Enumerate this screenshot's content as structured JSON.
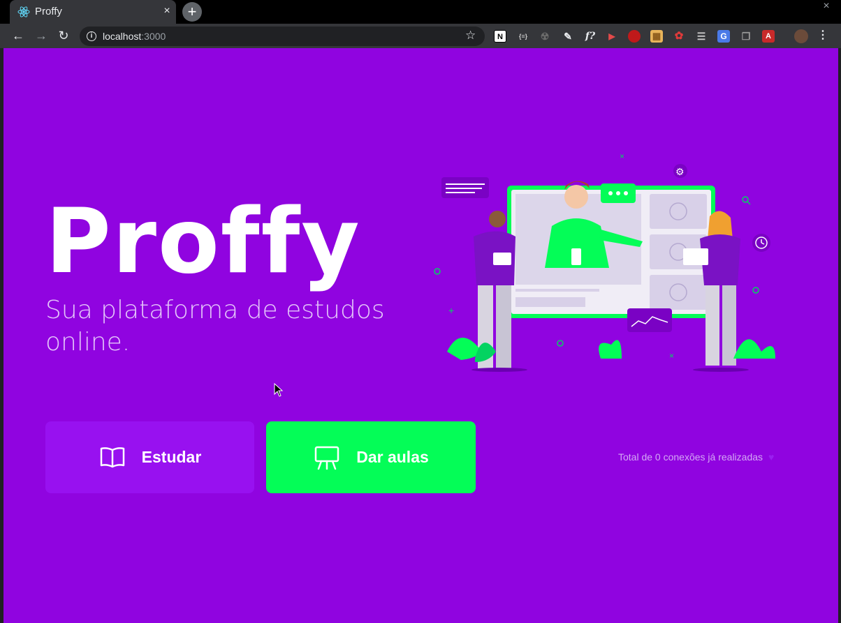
{
  "browser": {
    "tab_title": "Proffy",
    "tab_close": "×",
    "new_tab": "+",
    "window_close": "×",
    "url_host": "localhost",
    "url_port": ":3000",
    "back": "←",
    "forward": "→",
    "reload": "↻",
    "bookmark_icon": "star-icon",
    "menu": "⋮"
  },
  "extensions": [
    {
      "name": "notion-icon",
      "label": "N"
    },
    {
      "name": "json-icon",
      "label": "{≡}"
    },
    {
      "name": "radioactive-icon",
      "label": "☢"
    },
    {
      "name": "pen-icon",
      "label": "✎"
    },
    {
      "name": "function-icon",
      "label": "f?"
    },
    {
      "name": "video-icon",
      "label": "▶"
    },
    {
      "name": "rp-icon",
      "label": "●"
    },
    {
      "name": "note-icon",
      "label": "▦"
    },
    {
      "name": "octo-icon",
      "label": "✿"
    },
    {
      "name": "table-icon",
      "label": "☰"
    },
    {
      "name": "translate-icon",
      "label": "G"
    },
    {
      "name": "copy-icon",
      "label": "❐"
    },
    {
      "name": "pdf-icon",
      "label": "A"
    }
  ],
  "page": {
    "logo": "Proffy",
    "tagline": "Sua plataforma de estudos online.",
    "study_button": "Estudar",
    "teach_button": "Dar aulas",
    "connections_text": "Total de 0 conexões já realizadas",
    "colors": {
      "background": "#9004e0",
      "study_button": "#9811f0",
      "teach_button": "#04fd57",
      "text_light": "#e4c6fa"
    }
  }
}
